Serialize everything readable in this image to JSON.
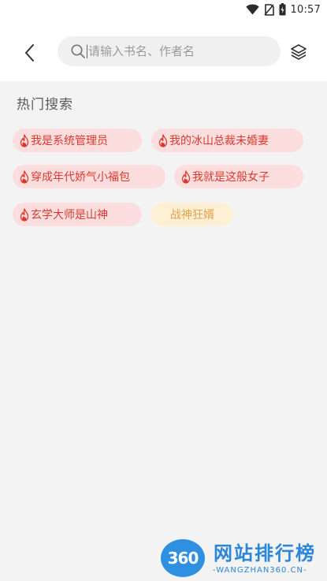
{
  "status_bar": {
    "time": "10:57",
    "icons": [
      "wifi-icon",
      "no-sim-icon",
      "battery-icon"
    ]
  },
  "header": {
    "back_icon": "chevron-left-icon",
    "search": {
      "placeholder": "请输入书名、作者名",
      "value": ""
    },
    "layers_icon": "layers-icon"
  },
  "hot_search": {
    "title": "热门搜索",
    "tags": [
      {
        "label": "我是系统管理员",
        "hot": true
      },
      {
        "label": "我的冰山总裁未婚妻",
        "hot": true
      },
      {
        "label": "穿成年代娇气小福包",
        "hot": true
      },
      {
        "label": "我就是这般女子",
        "hot": true
      },
      {
        "label": "玄学大师是山神",
        "hot": true
      },
      {
        "label": "战神狂婿",
        "hot": false
      }
    ]
  },
  "watermark": {
    "logo_text": "360",
    "brand": "网站排行榜",
    "url": "-WANGZHAN360.CN-"
  },
  "colors": {
    "hot_tag_bg": "#fcdede",
    "hot_tag_text": "#d8392f",
    "plain_tag_bg": "#fdf0d4",
    "plain_tag_text": "#e6a24a",
    "page_bg": "#f3f3f4"
  }
}
